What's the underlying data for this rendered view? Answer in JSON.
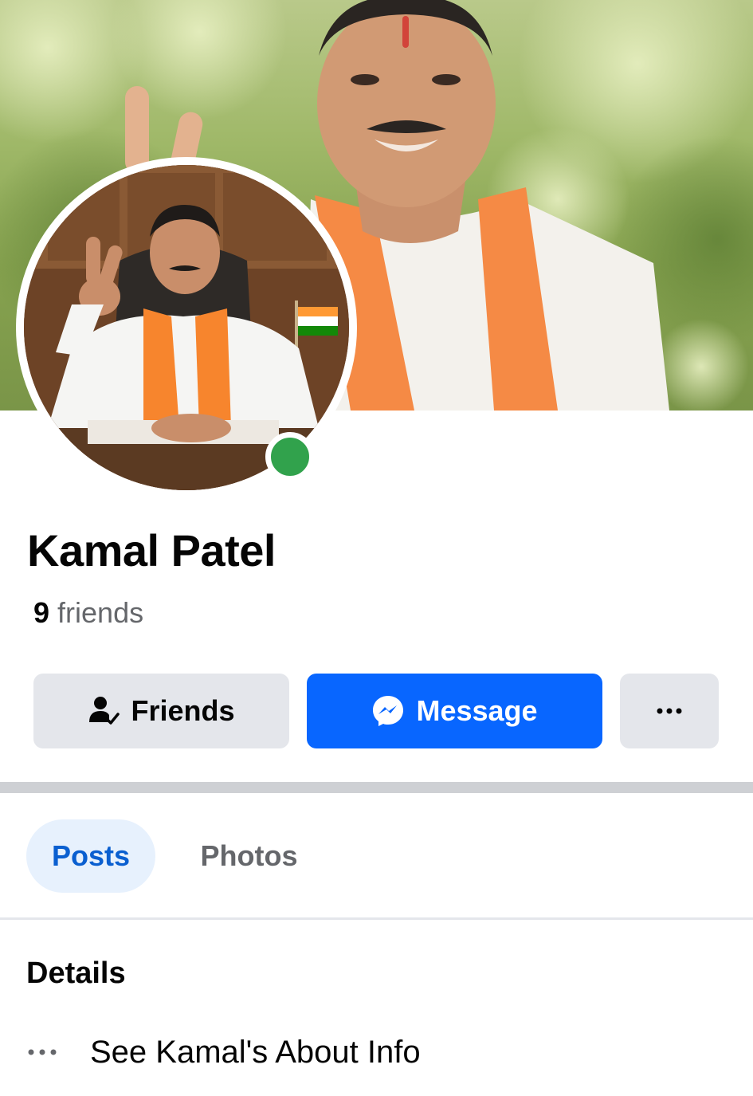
{
  "profile": {
    "name": "Kamal Patel",
    "friends_count": "9",
    "friends_label": "friends",
    "online": true
  },
  "actions": {
    "friends_label": "Friends",
    "message_label": "Message",
    "more_label": "···"
  },
  "tabs": [
    {
      "label": "Posts",
      "active": true
    },
    {
      "label": "Photos",
      "active": false
    }
  ],
  "details": {
    "title": "Details",
    "about_label": "See Kamal's About Info"
  },
  "colors": {
    "accent": "#0866ff",
    "online": "#31a24c",
    "tab_active_bg": "#e7f1fd",
    "tab_active_text": "#0a5fd0",
    "button_gray": "#e4e6eb"
  },
  "icons": {
    "friends_button": "person-check-icon",
    "message_button": "messenger-icon",
    "more_button": "more-icon",
    "about_row": "more-horizontal-icon"
  }
}
